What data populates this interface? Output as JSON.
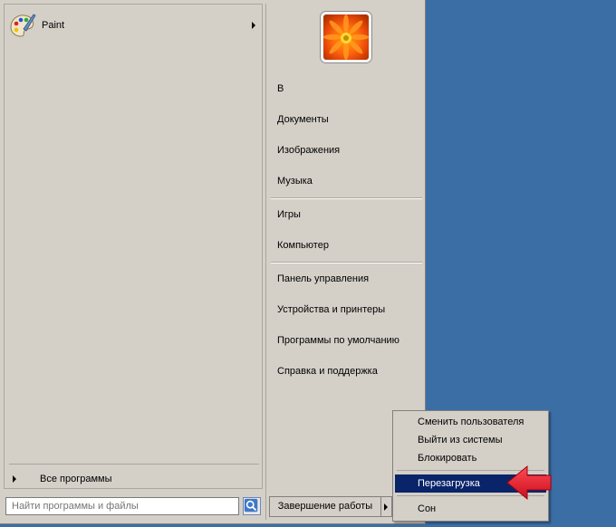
{
  "left_pane": {
    "app": {
      "label": "Paint",
      "icon": "paint-palette-icon"
    },
    "all_programs": "Все программы"
  },
  "search": {
    "placeholder": "Найти программы и файлы",
    "icon": "search-icon"
  },
  "right_pane": {
    "user_picture": "flower-icon",
    "items": [
      "В",
      "Документы",
      "Изображения",
      "Музыка",
      "Игры",
      "Компьютер",
      "Панель управления",
      "Устройства и принтеры",
      "Программы по умолчанию",
      "Справка и поддержка"
    ]
  },
  "shutdown": {
    "label": "Завершение работы"
  },
  "submenu": {
    "items": [
      "Сменить пользователя",
      "Выйти из системы",
      "Блокировать",
      "Перезагрузка",
      "Сон"
    ],
    "highlighted": "Перезагрузка"
  },
  "colors": {
    "desktop": "#3a6ea5",
    "menu": "#d4d0c8",
    "highlight": "#0a246a",
    "annotation_arrow": "#e8192c"
  }
}
